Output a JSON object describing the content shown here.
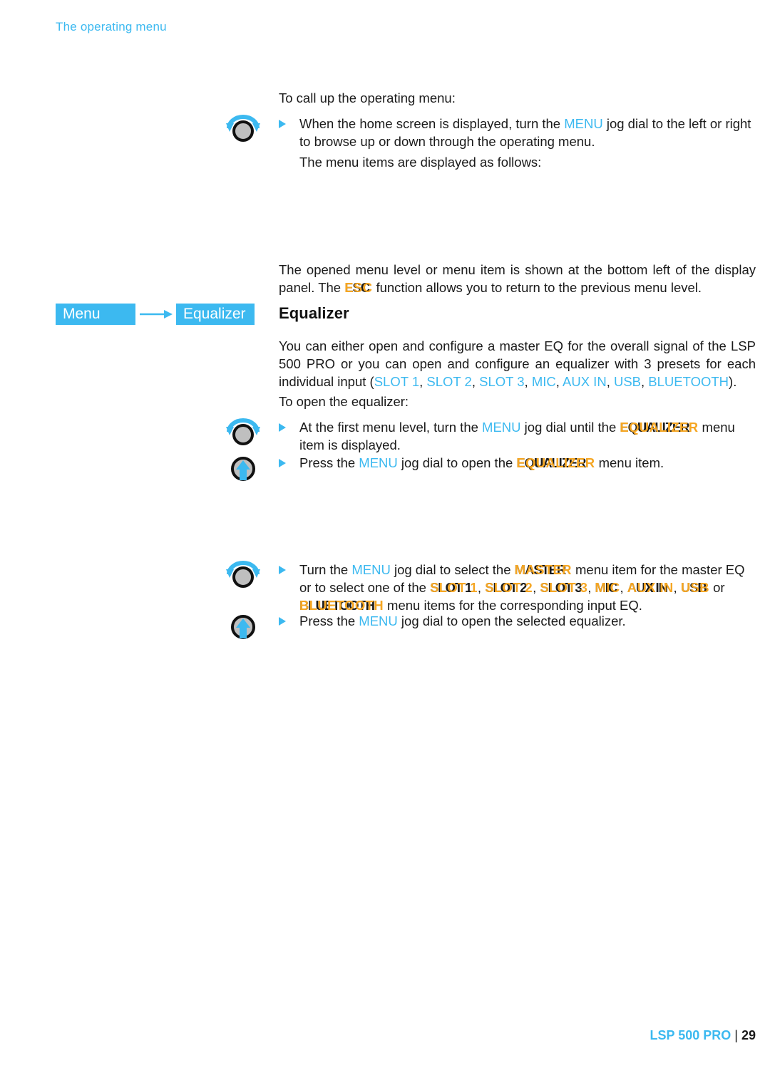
{
  "running_head": "The operating menu",
  "intro": {
    "lead": "To call up the operating menu:",
    "bullet1_a": "When the home screen is displayed, turn the ",
    "bullet1_menu": "MENU",
    "bullet1_b": " jog dial to the left or right to browse up or down through the operating menu.",
    "bullet1_follow": "The menu items are displayed as follows:"
  },
  "note": {
    "line_a": "The opened menu level or menu item is shown at the bottom left of the display panel. The ",
    "esc": "ESC",
    "line_b": " function allows you to return to the previous menu level."
  },
  "breadcrumb": {
    "step1": "Menu",
    "step2": "Equalizer",
    "arrow_icon": "arrow-right-icon"
  },
  "section": {
    "heading": "Equalizer",
    "body_a": "You can either open and configure a master EQ for the overall signal of the LSP 500 PRO or you can open and configure an equalizer with 3 presets for each individual input (",
    "inputs": [
      "SLOT 1",
      "SLOT 2",
      "SLOT 3",
      "MIC",
      "AUX IN",
      "USB",
      "BLUETOOTH"
    ],
    "body_b": ").",
    "open_lead": "To open the equalizer:"
  },
  "open_steps": [
    {
      "icon": "jog-dial-turn-icon",
      "a": "At the first menu level, turn the ",
      "menu": "MENU",
      "b": " jog dial until the ",
      "term": "EQUALIZER",
      "c": " menu item is displayed."
    },
    {
      "icon": "jog-dial-press-icon",
      "a": "Press the ",
      "menu": "MENU",
      "b": " jog dial to open the ",
      "term": "EQUALIZER",
      "c": " menu item."
    }
  ],
  "select_steps": [
    {
      "icon": "jog-dial-turn-icon",
      "a": "Turn the ",
      "menu": "MENU",
      "b": " jog dial to select the ",
      "term": "MASTER",
      "c": " menu item for the master EQ or to select one of the ",
      "terms": [
        "SLOT 1",
        "SLOT 2",
        "SLOT 3",
        "MIC",
        "AUX IN",
        "USB"
      ],
      "or": " or ",
      "term_last": "BLUETOOTH",
      "d": " menu items for the corresponding input EQ."
    },
    {
      "icon": "jog-dial-press-icon",
      "a": "Press the ",
      "menu": "MENU",
      "b": " jog dial to open the selected equalizer."
    }
  ],
  "footer": {
    "doc": "LSP 500 PRO",
    "separator": "|",
    "page": "29"
  },
  "colors": {
    "accent_blue": "#3cb9f0",
    "term_orange": "#f5a623",
    "text": "#1a1a1a"
  }
}
